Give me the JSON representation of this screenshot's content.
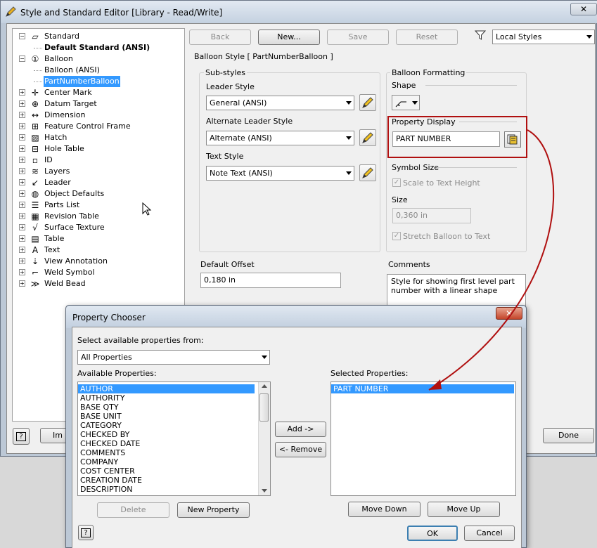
{
  "main_window": {
    "title": "Style and Standard Editor [Library - Read/Write]",
    "close_label": "✕",
    "tree": [
      {
        "label": "Standard",
        "expander": "−",
        "icon": "standard-icon",
        "indent": 0
      },
      {
        "label": "Default Standard (ANSI)",
        "expander": "",
        "icon": "",
        "indent": 1,
        "bold": true
      },
      {
        "label": "Balloon",
        "expander": "−",
        "icon": "balloon-icon",
        "indent": 0
      },
      {
        "label": "Balloon (ANSI)",
        "expander": "",
        "icon": "",
        "indent": 1
      },
      {
        "label": "PartNumberBalloon",
        "expander": "",
        "icon": "",
        "indent": 1,
        "selected": true
      },
      {
        "label": "Center Mark",
        "expander": "+",
        "icon": "center-mark-icon",
        "indent": 0
      },
      {
        "label": "Datum Target",
        "expander": "+",
        "icon": "datum-target-icon",
        "indent": 0
      },
      {
        "label": "Dimension",
        "expander": "+",
        "icon": "dimension-icon",
        "indent": 0
      },
      {
        "label": "Feature Control Frame",
        "expander": "+",
        "icon": "feature-control-frame-icon",
        "indent": 0
      },
      {
        "label": "Hatch",
        "expander": "+",
        "icon": "hatch-icon",
        "indent": 0
      },
      {
        "label": "Hole Table",
        "expander": "+",
        "icon": "hole-table-icon",
        "indent": 0
      },
      {
        "label": "ID",
        "expander": "+",
        "icon": "id-icon",
        "indent": 0
      },
      {
        "label": "Layers",
        "expander": "+",
        "icon": "layers-icon",
        "indent": 0
      },
      {
        "label": "Leader",
        "expander": "+",
        "icon": "leader-icon",
        "indent": 0
      },
      {
        "label": "Object Defaults",
        "expander": "+",
        "icon": "object-defaults-icon",
        "indent": 0
      },
      {
        "label": "Parts List",
        "expander": "+",
        "icon": "parts-list-icon",
        "indent": 0
      },
      {
        "label": "Revision Table",
        "expander": "+",
        "icon": "revision-table-icon",
        "indent": 0
      },
      {
        "label": "Surface Texture",
        "expander": "+",
        "icon": "surface-texture-icon",
        "indent": 0
      },
      {
        "label": "Table",
        "expander": "+",
        "icon": "table-icon",
        "indent": 0
      },
      {
        "label": "Text",
        "expander": "+",
        "icon": "text-icon",
        "indent": 0
      },
      {
        "label": "View Annotation",
        "expander": "+",
        "icon": "view-annotation-icon",
        "indent": 0
      },
      {
        "label": "Weld Symbol",
        "expander": "+",
        "icon": "weld-symbol-icon",
        "indent": 0
      },
      {
        "label": "Weld Bead",
        "expander": "+",
        "icon": "weld-bead-icon",
        "indent": 0
      }
    ],
    "toolbar": {
      "back": "Back",
      "new": "New...",
      "save": "Save",
      "reset": "Reset",
      "filter_value": "Local Styles"
    },
    "section_title": "Balloon Style [ PartNumberBalloon ]",
    "substyles": {
      "group_label": "Sub-styles",
      "leader_style_label": "Leader Style",
      "leader_style_value": "General (ANSI)",
      "alt_leader_label": "Alternate Leader Style",
      "alt_leader_value": "Alternate (ANSI)",
      "text_style_label": "Text Style",
      "text_style_value": "Note Text (ANSI)"
    },
    "formatting": {
      "group_label": "Balloon Formatting",
      "shape_label": "Shape",
      "property_display_label": "Property Display",
      "property_display_value": "PART NUMBER",
      "symbol_size_label": "Symbol Size",
      "scale_label": "Scale to Text Height",
      "size_label": "Size",
      "size_value": "0,360 in",
      "stretch_label": "Stretch Balloon to Text"
    },
    "default_offset_label": "Default Offset",
    "default_offset_value": "0,180 in",
    "comments_label": "Comments",
    "comments_value": "Style for showing first level part number with a linear shape",
    "help_label": "?",
    "import_partial": "Im",
    "done": "Done"
  },
  "dialog": {
    "title": "Property Chooser",
    "close_label": "✕",
    "source_label": "Select available properties from:",
    "source_value": "All Properties",
    "available_label": "Available Properties:",
    "available": [
      "AUTHOR",
      "AUTHORITY",
      "BASE QTY",
      "BASE UNIT",
      "CATEGORY",
      "CHECKED BY",
      "CHECKED DATE",
      "COMMENTS",
      "COMPANY",
      "COST CENTER",
      "CREATION DATE",
      "DESCRIPTION"
    ],
    "selected_label": "Selected Properties:",
    "selected": [
      "PART NUMBER"
    ],
    "add": "Add ->",
    "remove": "<- Remove",
    "delete": "Delete",
    "new_property": "New Property",
    "move_down": "Move Down",
    "move_up": "Move Up",
    "help_label": "?",
    "ok": "OK",
    "cancel": "Cancel"
  },
  "colors": {
    "highlight": "#3399ff",
    "annotation_red": "#b01010"
  }
}
